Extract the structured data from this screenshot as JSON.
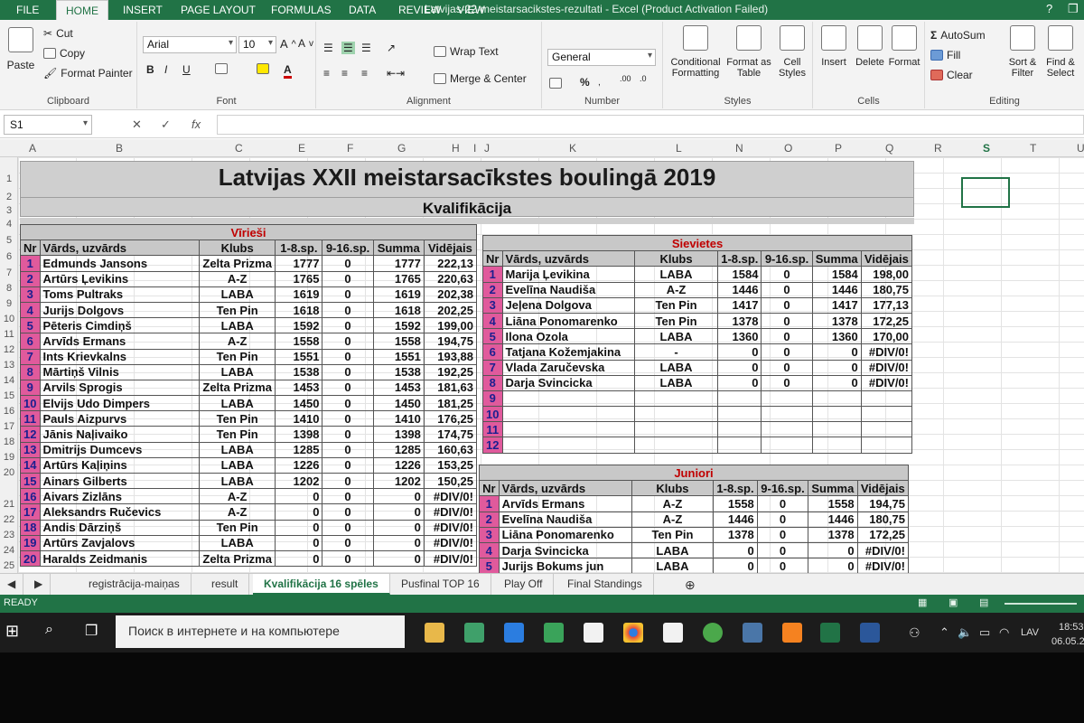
{
  "window": {
    "title": "Latvijas-22-meistarsacikstes-rezultati - Excel (Product Activation Failed)",
    "help": "?"
  },
  "ribbon_tabs": [
    "FILE",
    "HOME",
    "INSERT",
    "PAGE LAYOUT",
    "FORMULAS",
    "DATA",
    "REVIEW",
    "VIEW"
  ],
  "clipboard": {
    "paste": "Paste",
    "cut": "Cut",
    "copy": "Copy",
    "format_painter": "Format Painter",
    "label": "Clipboard"
  },
  "font": {
    "name": "Arial",
    "size": "10",
    "label": "Font",
    "bold": "B",
    "italic": "I",
    "underline": "U"
  },
  "alignment": {
    "wrap": "Wrap Text",
    "merge": "Merge & Center",
    "label": "Alignment"
  },
  "number": {
    "format": "General",
    "label": "Number",
    "percent": "%"
  },
  "styles": {
    "conditional": "Conditional Formatting",
    "format_table": "Format as Table",
    "cell_styles": "Cell Styles",
    "label": "Styles"
  },
  "cells": {
    "insert": "Insert",
    "delete": "Delete",
    "format": "Format",
    "label": "Cells"
  },
  "editing": {
    "autosum": "AutoSum",
    "fill": "Fill",
    "clear": "Clear",
    "sort": "Sort & Filter",
    "find": "Find & Select",
    "label": "Editing"
  },
  "formula_bar": {
    "name_box": "S1",
    "fx": "fx"
  },
  "columns": [
    "A",
    "B",
    "C",
    "E",
    "F",
    "G",
    "H",
    "I",
    "J",
    "K",
    "L",
    "N",
    "O",
    "P",
    "Q",
    "R",
    "S",
    "T",
    "U"
  ],
  "rows": [
    "1",
    "2",
    "3",
    "4",
    "5",
    "6",
    "7",
    "8",
    "9",
    "10",
    "11",
    "12",
    "13",
    "14",
    "15",
    "16",
    "17",
    "18",
    "19",
    "20",
    "21",
    "22",
    "23",
    "24",
    "25"
  ],
  "sheet": {
    "title": "Latvijas XXII meistarsacīkstes boulingā 2019",
    "subtitle": "Kvalifikācija",
    "headers": [
      "Nr",
      "Vārds, uzvārds",
      "Klubs",
      "1-8.sp.",
      "9-16.sp.",
      "Summa",
      "Vidējais"
    ],
    "men": {
      "caption": "Vīrieši",
      "rows": [
        [
          "1",
          "Edmunds Jansons",
          "Zelta Prizma",
          "1777",
          "0",
          "1777",
          "222,13"
        ],
        [
          "2",
          "Artūrs Ļevikins",
          "A-Z",
          "1765",
          "0",
          "1765",
          "220,63"
        ],
        [
          "3",
          "Toms Pultraks",
          "LABA",
          "1619",
          "0",
          "1619",
          "202,38"
        ],
        [
          "4",
          "Jurijs Dolgovs",
          "Ten Pin",
          "1618",
          "0",
          "1618",
          "202,25"
        ],
        [
          "5",
          "Pēteris Cimdiņš",
          "LABA",
          "1592",
          "0",
          "1592",
          "199,00"
        ],
        [
          "6",
          "Arvīds Ermans",
          "A-Z",
          "1558",
          "0",
          "1558",
          "194,75"
        ],
        [
          "7",
          "Ints Krievkalns",
          "Ten Pin",
          "1551",
          "0",
          "1551",
          "193,88"
        ],
        [
          "8",
          "Mārtiņš Vilnis",
          "LABA",
          "1538",
          "0",
          "1538",
          "192,25"
        ],
        [
          "9",
          "Arvils Sprogis",
          "Zelta Prizma",
          "1453",
          "0",
          "1453",
          "181,63"
        ],
        [
          "10",
          "Elvijs Udo Dimpers",
          "LABA",
          "1450",
          "0",
          "1450",
          "181,25"
        ],
        [
          "11",
          "Pauls Aizpurvs",
          "Ten Pin",
          "1410",
          "0",
          "1410",
          "176,25"
        ],
        [
          "12",
          "Jānis Naļivaiko",
          "Ten Pin",
          "1398",
          "0",
          "1398",
          "174,75"
        ],
        [
          "13",
          "Dmitrijs Dumcevs",
          "LABA",
          "1285",
          "0",
          "1285",
          "160,63"
        ],
        [
          "14",
          "Artūrs Kaļiņins",
          "LABA",
          "1226",
          "0",
          "1226",
          "153,25"
        ],
        [
          "15",
          "Ainars Gilberts",
          "LABA",
          "1202",
          "0",
          "1202",
          "150,25"
        ],
        [
          "16",
          "Aivars Zizlāns",
          "A-Z",
          "0",
          "0",
          "0",
          "#DIV/0!"
        ],
        [
          "17",
          "Aleksandrs Ručevics",
          "A-Z",
          "0",
          "0",
          "0",
          "#DIV/0!"
        ],
        [
          "18",
          "Andis Dārziņš",
          "Ten Pin",
          "0",
          "0",
          "0",
          "#DIV/0!"
        ],
        [
          "19",
          "Artūrs Zavjalovs",
          "LABA",
          "0",
          "0",
          "0",
          "#DIV/0!"
        ],
        [
          "20",
          "Haralds Zeidmanis",
          "Zelta Prizma",
          "0",
          "0",
          "0",
          "#DIV/0!"
        ]
      ]
    },
    "women": {
      "caption": "Sievietes",
      "rows": [
        [
          "1",
          "Marija Ļevikina",
          "LABA",
          "1584",
          "0",
          "1584",
          "198,00"
        ],
        [
          "2",
          "Evelīna Naudiša",
          "A-Z",
          "1446",
          "0",
          "1446",
          "180,75"
        ],
        [
          "3",
          "Jeļena Dolgova",
          "Ten Pin",
          "1417",
          "0",
          "1417",
          "177,13"
        ],
        [
          "4",
          "Liāna Ponomarenko",
          "Ten Pin",
          "1378",
          "0",
          "1378",
          "172,25"
        ],
        [
          "5",
          "Ilona Ozola",
          "LABA",
          "1360",
          "0",
          "1360",
          "170,00"
        ],
        [
          "6",
          "Tatjana Kožemjakina",
          "-",
          "0",
          "0",
          "0",
          "#DIV/0!"
        ],
        [
          "7",
          "Vlada Zaručevska",
          "LABA",
          "0",
          "0",
          "0",
          "#DIV/0!"
        ],
        [
          "8",
          "Darja Svincicka",
          "LABA",
          "0",
          "0",
          "0",
          "#DIV/0!"
        ],
        [
          "9",
          "",
          "",
          "",
          "",
          "",
          ""
        ],
        [
          "10",
          "",
          "",
          "",
          "",
          "",
          ""
        ],
        [
          "11",
          "",
          "",
          "",
          "",
          "",
          ""
        ],
        [
          "12",
          "",
          "",
          "",
          "",
          "",
          ""
        ]
      ]
    },
    "juniors": {
      "caption": "Juniori",
      "rows": [
        [
          "1",
          "Arvīds Ermans",
          "A-Z",
          "1558",
          "0",
          "1558",
          "194,75"
        ],
        [
          "2",
          "Evelīna Naudiša",
          "A-Z",
          "1446",
          "0",
          "1446",
          "180,75"
        ],
        [
          "3",
          "Liāna Ponomarenko",
          "Ten Pin",
          "1378",
          "0",
          "1378",
          "172,25"
        ],
        [
          "4",
          "Darja Svincicka",
          "LABA",
          "0",
          "0",
          "0",
          "#DIV/0!"
        ],
        [
          "5",
          "Jurijs Bokums jun",
          "LABA",
          "0",
          "0",
          "0",
          "#DIV/0!"
        ]
      ]
    }
  },
  "sheet_tabs": [
    "registrācija-maiņas",
    "result",
    "Kvalifikācija 16 spēles",
    "Pusfinal TOP 16",
    "Play Off",
    "Final Standings"
  ],
  "active_sheet": "Kvalifikācija 16 spēles",
  "status": {
    "ready": "READY"
  },
  "taskbar": {
    "search_placeholder": "Поиск в интернете и на компьютере",
    "lang": "LAV",
    "time": "18:53",
    "date": "06.05.20"
  },
  "colors": {
    "excel_green": "#217346",
    "nr_pink": "#e05a9c",
    "caption_red": "#c00000",
    "header_gray": "#c8c8c8"
  }
}
